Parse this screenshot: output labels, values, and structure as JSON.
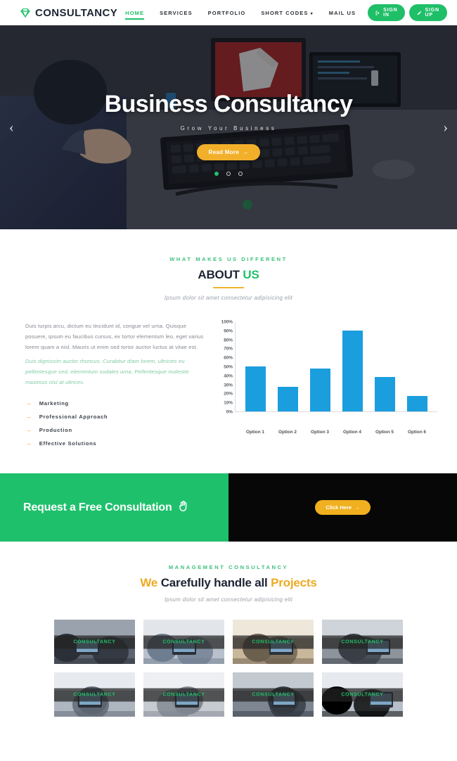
{
  "header": {
    "brand": "CONSULTANCY",
    "brand_icon": "diamond-icon",
    "nav": [
      {
        "label": "HOME",
        "active": true,
        "caret": false
      },
      {
        "label": "SERVICES",
        "active": false,
        "caret": false
      },
      {
        "label": "PORTFOLIO",
        "active": false,
        "caret": false
      },
      {
        "label": "SHORT CODES",
        "active": false,
        "caret": true
      },
      {
        "label": "MAIL US",
        "active": false,
        "caret": false
      }
    ],
    "sign_in": "SIGN IN",
    "sign_up": "SIGN UP",
    "accent_green": "#1fbf68",
    "brand_dark": "#1d2433"
  },
  "hero": {
    "title": "Business Consultancy",
    "subtitle": "Grow Your Business",
    "button": "Read More",
    "button_arrow": "→",
    "prev_arrow": "‹",
    "next_arrow": "›",
    "dots": 3,
    "active_dot": 0,
    "button_color": "#f2b02a"
  },
  "about": {
    "eyebrow": "WHAT MAKES US DIFFERENT",
    "title_1": "ABOUT",
    "title_2": "US",
    "description": "Ipsum dolor sit amet consectetur adipisicing elit",
    "paragraph": "Duis turpis arcu, dictum eu tincidunt id, congue vel urna. Quisque posuere, ipsum eu faucibus cursus, ex tortor elementum leo, eget varius lorem quam a nisl. Mauris ut enim sed tortor auctor luctus at vitae est.",
    "paragraph_accent": "Duis dignissim auctor rhoncus. Curabitur diam lorem, ultricies eu pellentesque sed, elementum sodales urna. Pellentesque molestie maximus nisl at ultrices.",
    "list": [
      "Marketing",
      "Professional Approach",
      "Production",
      "Effective Solutions"
    ],
    "list_bullet": "→"
  },
  "chart_data": {
    "type": "bar",
    "title": "",
    "xlabel": "",
    "ylabel": "",
    "categories": [
      "Option 1",
      "Option 2",
      "Option 3",
      "Option 4",
      "Option 5",
      "Option 6"
    ],
    "values": [
      50,
      27,
      48,
      90,
      38,
      17
    ],
    "ylim": [
      0,
      100
    ],
    "yticks": [
      100,
      90,
      80,
      70,
      60,
      50,
      40,
      30,
      20,
      10,
      0
    ],
    "ytick_labels": [
      "100%",
      "90%",
      "80%",
      "70%",
      "60%",
      "50%",
      "40%",
      "30%",
      "20%",
      "10%",
      "0%"
    ],
    "grid": false,
    "legend": false,
    "bar_color": "#1b9ede"
  },
  "cta": {
    "text": "Request a Free Consultation",
    "hand_icon": "pointing-hand-icon",
    "button": "Click Here",
    "button_arrow": "→",
    "green": "#1fc06c",
    "dark": "#070707",
    "button_color": "#f0b01f"
  },
  "portfolio": {
    "eyebrow": "MANAGEMENT CONSULTANCY",
    "title_1": "We",
    "title_2": "Carefully handle all",
    "title_3": "Projects",
    "description": "Ipsum dolor sit amet consectetur adipisicing elit",
    "tiles": [
      {
        "label": "CONSULTANCY"
      },
      {
        "label": "CONSULTANCY"
      },
      {
        "label": "CONSULTANCY"
      },
      {
        "label": "CONSULTANCY"
      },
      {
        "label": "CONSULTANCY"
      },
      {
        "label": "CONSULTANCY"
      },
      {
        "label": "CONSULTANCY"
      },
      {
        "label": "CONSULTANCY"
      }
    ]
  }
}
